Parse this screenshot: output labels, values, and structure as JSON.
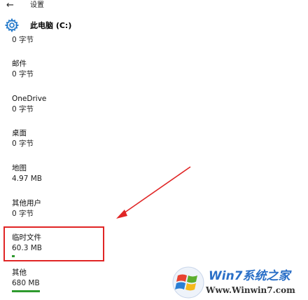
{
  "window": {
    "title": "设置",
    "back_icon": "back-arrow-icon"
  },
  "header": {
    "label": "此电脑 (C:)",
    "icon": "gear-icon",
    "accent": "#1a73c8"
  },
  "storage_items": [
    {
      "name": "",
      "size": "0 字节",
      "usage_fraction": 0
    },
    {
      "name": "邮件",
      "size": "0 字节",
      "usage_fraction": 0
    },
    {
      "name": "OneDrive",
      "size": "0 字节",
      "usage_fraction": 0
    },
    {
      "name": "桌面",
      "size": "0 字节",
      "usage_fraction": 0
    },
    {
      "name": "地图",
      "size": "4.97 MB",
      "usage_fraction": 0
    },
    {
      "name": "其他用户",
      "size": "0 字节",
      "usage_fraction": 0
    },
    {
      "name": "临时文件",
      "size": "60.3 MB",
      "usage_fraction": 0.01
    },
    {
      "name": "其他",
      "size": "680 MB",
      "usage_fraction": 0.1
    }
  ],
  "annotation": {
    "highlight_color": "#e02525",
    "highlighted_item": "临时文件"
  },
  "watermark": {
    "brand": "Win7系统之家",
    "url": "Www.Winwin7.com"
  }
}
